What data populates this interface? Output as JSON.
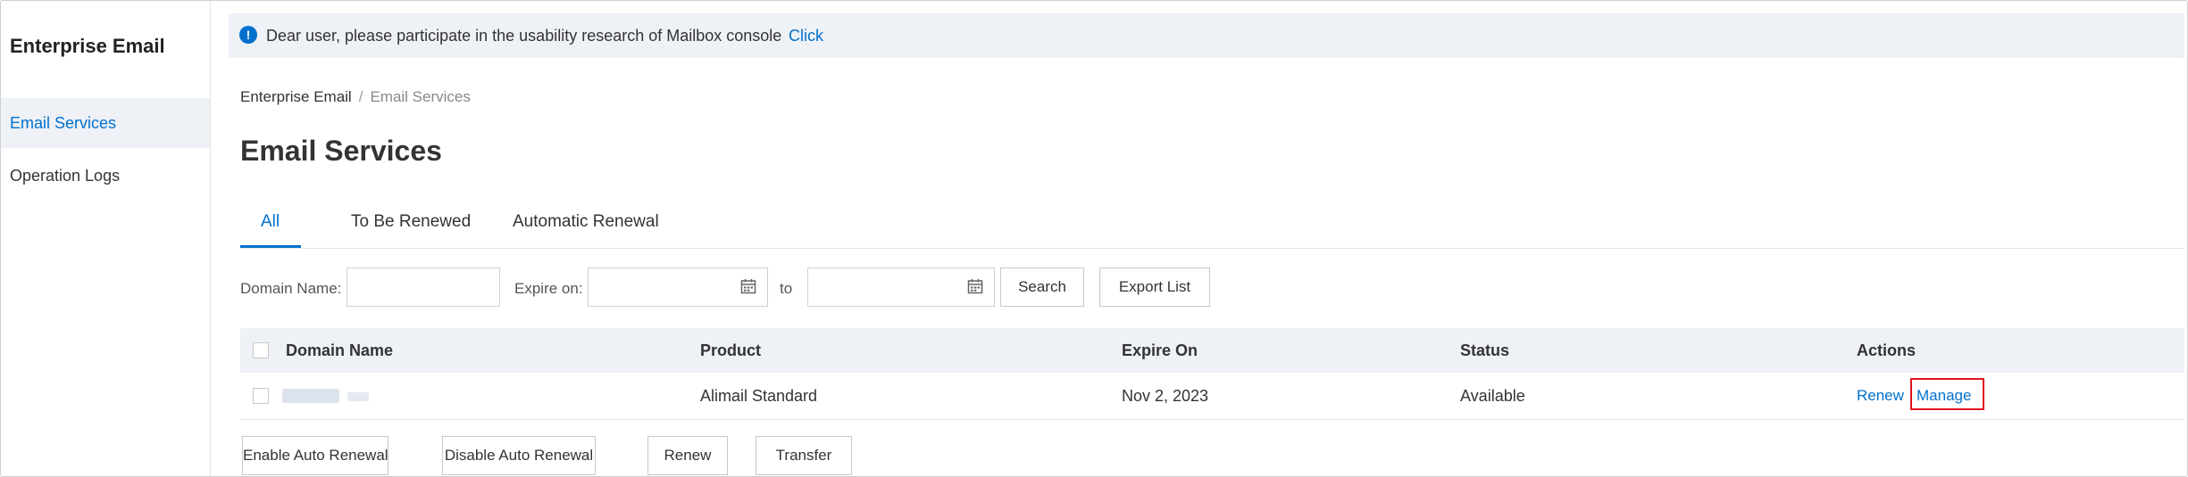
{
  "sidebar": {
    "title": "Enterprise Email",
    "items": [
      {
        "label": "Email Services",
        "active": true
      },
      {
        "label": "Operation Logs",
        "active": false
      }
    ]
  },
  "notice": {
    "icon": "info-icon",
    "text": "Dear user, please participate in the usability research of Mailbox console",
    "link": "Click"
  },
  "breadcrumb": {
    "root": "Enterprise Email",
    "separator": "/",
    "current": "Email Services"
  },
  "page_title": "Email Services",
  "tabs": [
    {
      "label": "All",
      "active": true
    },
    {
      "label": "To Be Renewed",
      "active": false
    },
    {
      "label": "Automatic Renewal",
      "active": false
    }
  ],
  "filters": {
    "domain_label": "Domain Name:",
    "domain_value": "",
    "expire_label": "Expire on:",
    "expire_from": "",
    "to_label": "to",
    "expire_to": "",
    "search_button": "Search",
    "export_button": "Export List"
  },
  "table": {
    "columns": [
      "Domain Name",
      "Product",
      "Expire On",
      "Status",
      "Actions"
    ],
    "rows": [
      {
        "domain": "",
        "product": "Alimail Standard",
        "expire_on": "Nov 2, 2023",
        "status": "Available",
        "actions": [
          "Renew",
          "Manage"
        ]
      }
    ]
  },
  "bulk_actions": {
    "enable_auto_renewal": "Enable Auto Renewal",
    "disable_auto_renewal": "Disable Auto Renewal",
    "renew": "Renew",
    "transfer": "Transfer"
  },
  "colors": {
    "accent": "#0070cc",
    "highlight_box": "#e0141e",
    "header_bg": "#eef1f6"
  }
}
